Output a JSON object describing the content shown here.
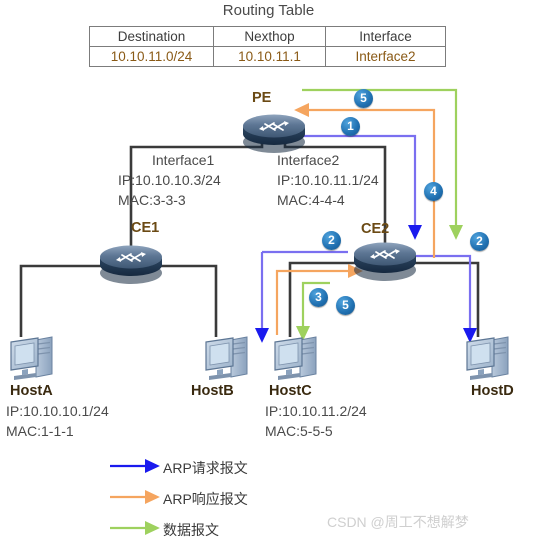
{
  "routing_table": {
    "title": "Routing Table",
    "headers": [
      "Destination",
      "Nexthop",
      "Interface"
    ],
    "rows": [
      [
        "10.10.11.0/24",
        "10.10.11.1",
        "Interface2"
      ]
    ]
  },
  "devices": {
    "pe": {
      "name": "PE"
    },
    "ce1": {
      "name": "CE1"
    },
    "ce2": {
      "name": "CE2"
    }
  },
  "interfaces": {
    "if1": {
      "name": "Interface1",
      "ip": "IP:10.10.10.3/24",
      "mac": "MAC:3-3-3"
    },
    "if2": {
      "name": "Interface2",
      "ip": "IP:10.10.11.1/24",
      "mac": "MAC:4-4-4"
    }
  },
  "hosts": {
    "a": {
      "name": "HostA",
      "ip": "IP:10.10.10.1/24",
      "mac": "MAC:1-1-1"
    },
    "b": {
      "name": "HostB"
    },
    "c": {
      "name": "HostC",
      "ip": "IP:10.10.11.2/24",
      "mac": "MAC:5-5-5"
    },
    "d": {
      "name": "HostD"
    }
  },
  "step_badges": [
    {
      "id": "badge-5-top",
      "label": "5"
    },
    {
      "id": "badge-1",
      "label": "1"
    },
    {
      "id": "badge-4",
      "label": "4"
    },
    {
      "id": "badge-2-left",
      "label": "2"
    },
    {
      "id": "badge-2-right",
      "label": "2"
    },
    {
      "id": "badge-3",
      "label": "3"
    },
    {
      "id": "badge-5-low",
      "label": "5"
    }
  ],
  "legend": [
    {
      "color": "#1a1aee",
      "label": "ARP请求报文"
    },
    {
      "color": "#f5a55f",
      "label": "ARP响应报文"
    },
    {
      "color": "#9ed15e",
      "label": "数据报文"
    }
  ],
  "colors": {
    "arp_request": "#1a1aee",
    "arp_request_line": "#7a6ff0",
    "arp_reply": "#f5a55f",
    "data": "#9ed15e",
    "link": "#3a3a3a",
    "badge": "#1f6fb0"
  },
  "watermark": "CSDN @周工不想解梦"
}
